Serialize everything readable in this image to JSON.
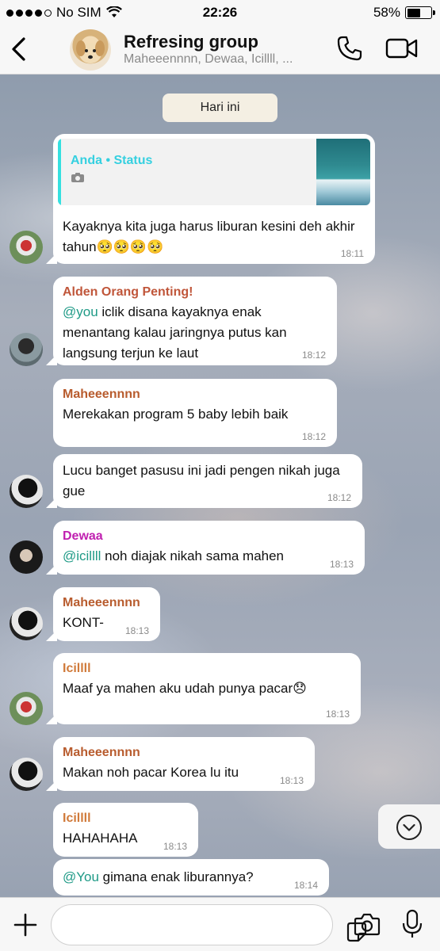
{
  "status_bar": {
    "carrier": "No SIM",
    "time": "22:26",
    "battery_percent": "58%",
    "battery_level": 0.58
  },
  "header": {
    "title": "Refresing group",
    "members": "Maheeennnn, Dewaa, Icillll, ..."
  },
  "date_divider": "Hari ini",
  "messages": [
    {
      "quote_label": "Anda • Status",
      "text": "Kayaknya kita juga harus liburan kesini deh akhir tahun🥺🥺🥺🥺",
      "time": "18:11"
    },
    {
      "sender": "Alden Orang Penting!",
      "sender_color": "#c0563a",
      "mention": "@you",
      "text": " iclik disana kayaknya enak menantang kalau jaringnya putus kan langsung terjun ke laut",
      "time": "18:12"
    },
    {
      "sender": "Maheeennnn",
      "sender_color": "#b85c2e",
      "text": "Merekakan program 5 baby lebih baik",
      "time": "18:12"
    },
    {
      "text": "Lucu banget pasusu ini jadi pengen nikah juga gue",
      "time": "18:12"
    },
    {
      "sender": "Dewaa",
      "sender_color": "#c020b0",
      "mention": "@icillll",
      "text": " noh diajak nikah sama mahen",
      "time": "18:13"
    },
    {
      "sender": "Maheeennnn",
      "sender_color": "#b85c2e",
      "text": "KONT-",
      "time": "18:13"
    },
    {
      "sender": "Icillll",
      "sender_color": "#d07a3a",
      "text": "Maaf ya mahen aku udah punya pacar😞",
      "time": "18:13"
    },
    {
      "sender": "Maheeennnn",
      "sender_color": "#b85c2e",
      "text": "Makan noh pacar Korea lu itu",
      "time": "18:13"
    },
    {
      "sender": "Icillll",
      "sender_color": "#d07a3a",
      "text": "HAHAHAHA",
      "time": "18:13"
    },
    {
      "mention": "@You",
      "text": " gimana enak liburannya?",
      "time": "18:14"
    }
  ],
  "colors": {
    "quote_accent": "#35e0e0",
    "mention": "#1e9a86"
  },
  "icons": [
    "back-chevron-icon",
    "phone-icon",
    "video-icon",
    "camera-icon",
    "chevron-down-icon",
    "plus-icon",
    "sticker-icon",
    "mic-icon"
  ]
}
